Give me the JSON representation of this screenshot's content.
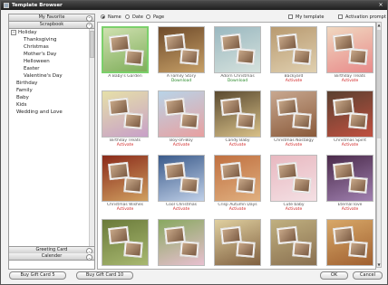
{
  "window": {
    "title": "Template Browser",
    "close_glyph": "×"
  },
  "sidebar": {
    "categories_top": [
      {
        "label": "My Favorite",
        "chev": "⌃"
      },
      {
        "label": "Scrapbook",
        "chev": "⌃"
      }
    ],
    "tree": [
      {
        "label": "Holiday",
        "toggle": "−",
        "level": 0
      },
      {
        "label": "Thanksgiving",
        "level": 1
      },
      {
        "label": "Christmas",
        "level": 1
      },
      {
        "label": "Mother's Day",
        "level": 1
      },
      {
        "label": "Helloween",
        "level": 1
      },
      {
        "label": "Easter",
        "level": 1
      },
      {
        "label": "Valentine's Day",
        "level": 1
      },
      {
        "label": "Birthday",
        "level": 0
      },
      {
        "label": "Family",
        "level": 0
      },
      {
        "label": "Baby",
        "level": 0
      },
      {
        "label": "Kids",
        "level": 0
      },
      {
        "label": "Wedding and Love",
        "level": 0
      }
    ],
    "categories_bottom": [
      {
        "label": "Greeting Card",
        "chev": "⌄"
      },
      {
        "label": "Calender",
        "chev": "⌄"
      }
    ]
  },
  "filters": {
    "sort_options": [
      "Name",
      "Date",
      "Page"
    ],
    "selected": "Name",
    "my_template": "My template",
    "activation_prompt": "Activation prompt"
  },
  "templates": [
    {
      "name": "A Baby's Garden",
      "status": "",
      "bg": "#cfe0b0",
      "accent": "#7fae5a",
      "selected": true
    },
    {
      "name": "A Family Story",
      "status": "Download",
      "bg": "#6e4a2a",
      "accent": "#c7a067"
    },
    {
      "name": "Adorn Christmas",
      "status": "Download",
      "bg": "#9ab8c0",
      "accent": "#d6e2dd"
    },
    {
      "name": "Backyard",
      "status": "Activate",
      "bg": "#b89a70",
      "accent": "#e0d0b0"
    },
    {
      "name": "Birthday Treats",
      "status": "Activate",
      "bg": "#f0d8c0",
      "accent": "#e88a8a"
    },
    {
      "name": "Birthday Treats",
      "status": "Activate",
      "bg": "#e6e0a8",
      "accent": "#c8a0c8"
    },
    {
      "name": "Boy-oh-Boy",
      "status": "Activate",
      "bg": "#b8d4e8",
      "accent": "#e8a0a0"
    },
    {
      "name": "Candy Baby",
      "status": "Activate",
      "bg": "#5a4a30",
      "accent": "#d8c088"
    },
    {
      "name": "Christmas Nostalgy",
      "status": "Activate",
      "bg": "#c8a890",
      "accent": "#8a5a3a"
    },
    {
      "name": "Christmas Spirit",
      "status": "Activate",
      "bg": "#5a4030",
      "accent": "#c05040"
    },
    {
      "name": "Christmas Wishes",
      "status": "Activate",
      "bg": "#8a2a1a",
      "accent": "#d0a060"
    },
    {
      "name": "Cool Christmas",
      "status": "Activate",
      "bg": "#3a5a8a",
      "accent": "#c0d0e8"
    },
    {
      "name": "Crisp Autumn Days",
      "status": "Activate",
      "bg": "#c07040",
      "accent": "#e0b080"
    },
    {
      "name": "Cute baby",
      "status": "Activate",
      "bg": "#e8b8c0",
      "accent": "#f4e0e4"
    },
    {
      "name": "Eternal love",
      "status": "Activate",
      "bg": "#4a2a4a",
      "accent": "#a080b0"
    },
    {
      "name": "",
      "status": "",
      "bg": "#6a7a3a",
      "accent": "#a8b870"
    },
    {
      "name": "",
      "status": "",
      "bg": "#88a860",
      "accent": "#e8c0d0"
    },
    {
      "name": "",
      "status": "",
      "bg": "#e0d0a0",
      "accent": "#806040"
    },
    {
      "name": "",
      "status": "",
      "bg": "#c0b080",
      "accent": "#8a7050"
    },
    {
      "name": "",
      "status": "",
      "bg": "#d8a868",
      "accent": "#a06030"
    }
  ],
  "colors": {
    "download": "#2a8a2a",
    "activate": "#d02020"
  },
  "footer": {
    "gift5": "Buy Gift Card 5",
    "gift10": "Buy Gift Card 10",
    "ok": "OK",
    "cancel": "Cancel"
  },
  "scroll": {
    "up": "▲",
    "down": "▼"
  }
}
